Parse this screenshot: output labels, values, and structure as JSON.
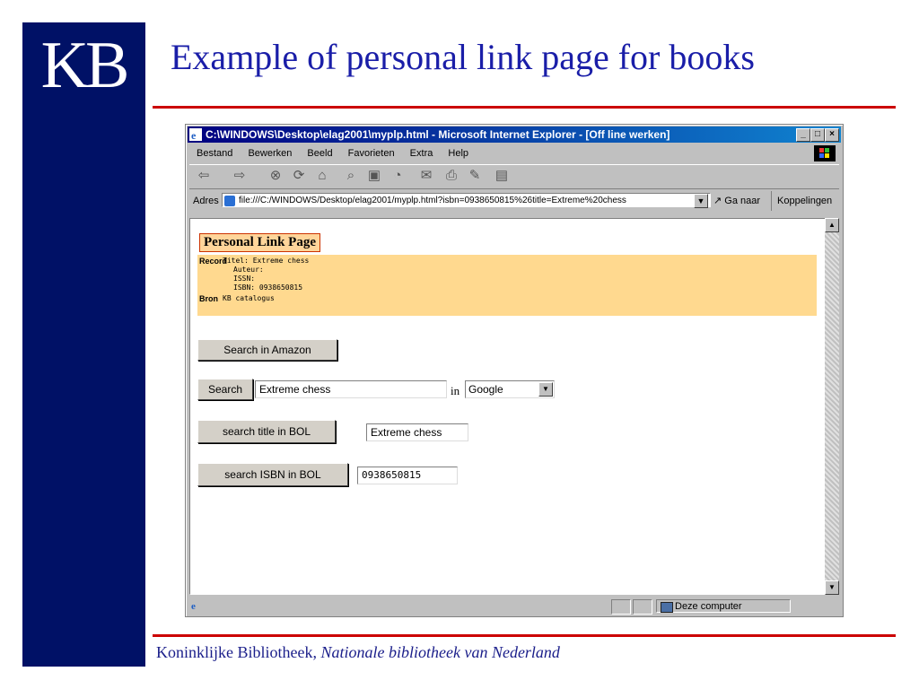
{
  "slide": {
    "logo": "KB",
    "title": "Example of personal link page for books",
    "footer_normal": "Koninklijke Bibliotheek, ",
    "footer_italic": "Nationale bibliotheek van Nederland",
    "colors": {
      "navy": "#001166",
      "rule": "#cc0000",
      "title": "#1a1ea8"
    }
  },
  "window": {
    "title": "C:\\WINDOWS\\Desktop\\elag2001\\myplp.html - Microsoft Internet Explorer - [Off line werken]",
    "menu": [
      "Bestand",
      "Bewerken",
      "Beeld",
      "Favorieten",
      "Extra",
      "Help"
    ],
    "toolbar_icons": [
      "back-icon",
      "forward-icon",
      "stop-icon",
      "refresh-icon",
      "home-icon",
      "search-icon",
      "favorites-icon",
      "history-icon",
      "mail-icon",
      "print-icon",
      "edit-icon",
      "discuss-icon"
    ],
    "address_label": "Adres",
    "address_url": "file:///C:/WINDOWS/Desktop/elag2001/myplp.html?isbn=0938650815%26title=Extreme%20chess",
    "go_label": "Ga naar",
    "links_label": "Koppelingen",
    "status_zone": "Deze computer"
  },
  "page": {
    "heading": "Personal Link Page",
    "record_label": "Record",
    "record_lines": [
      "Titel: Extreme chess",
      "Auteur:",
      "ISSN:",
      "ISBN: 0938650815"
    ],
    "bron_label": "Bron",
    "bron_value": "KB catalogus",
    "amazon_button": "Search in Amazon",
    "search_button": "Search",
    "search_value": "Extreme chess",
    "in_word": "in",
    "engine_selected": "Google",
    "bol_title_button": "search title in BOL",
    "bol_title_value": "Extreme chess",
    "bol_isbn_button": "search ISBN in BOL",
    "bol_isbn_value": "0938650815"
  }
}
